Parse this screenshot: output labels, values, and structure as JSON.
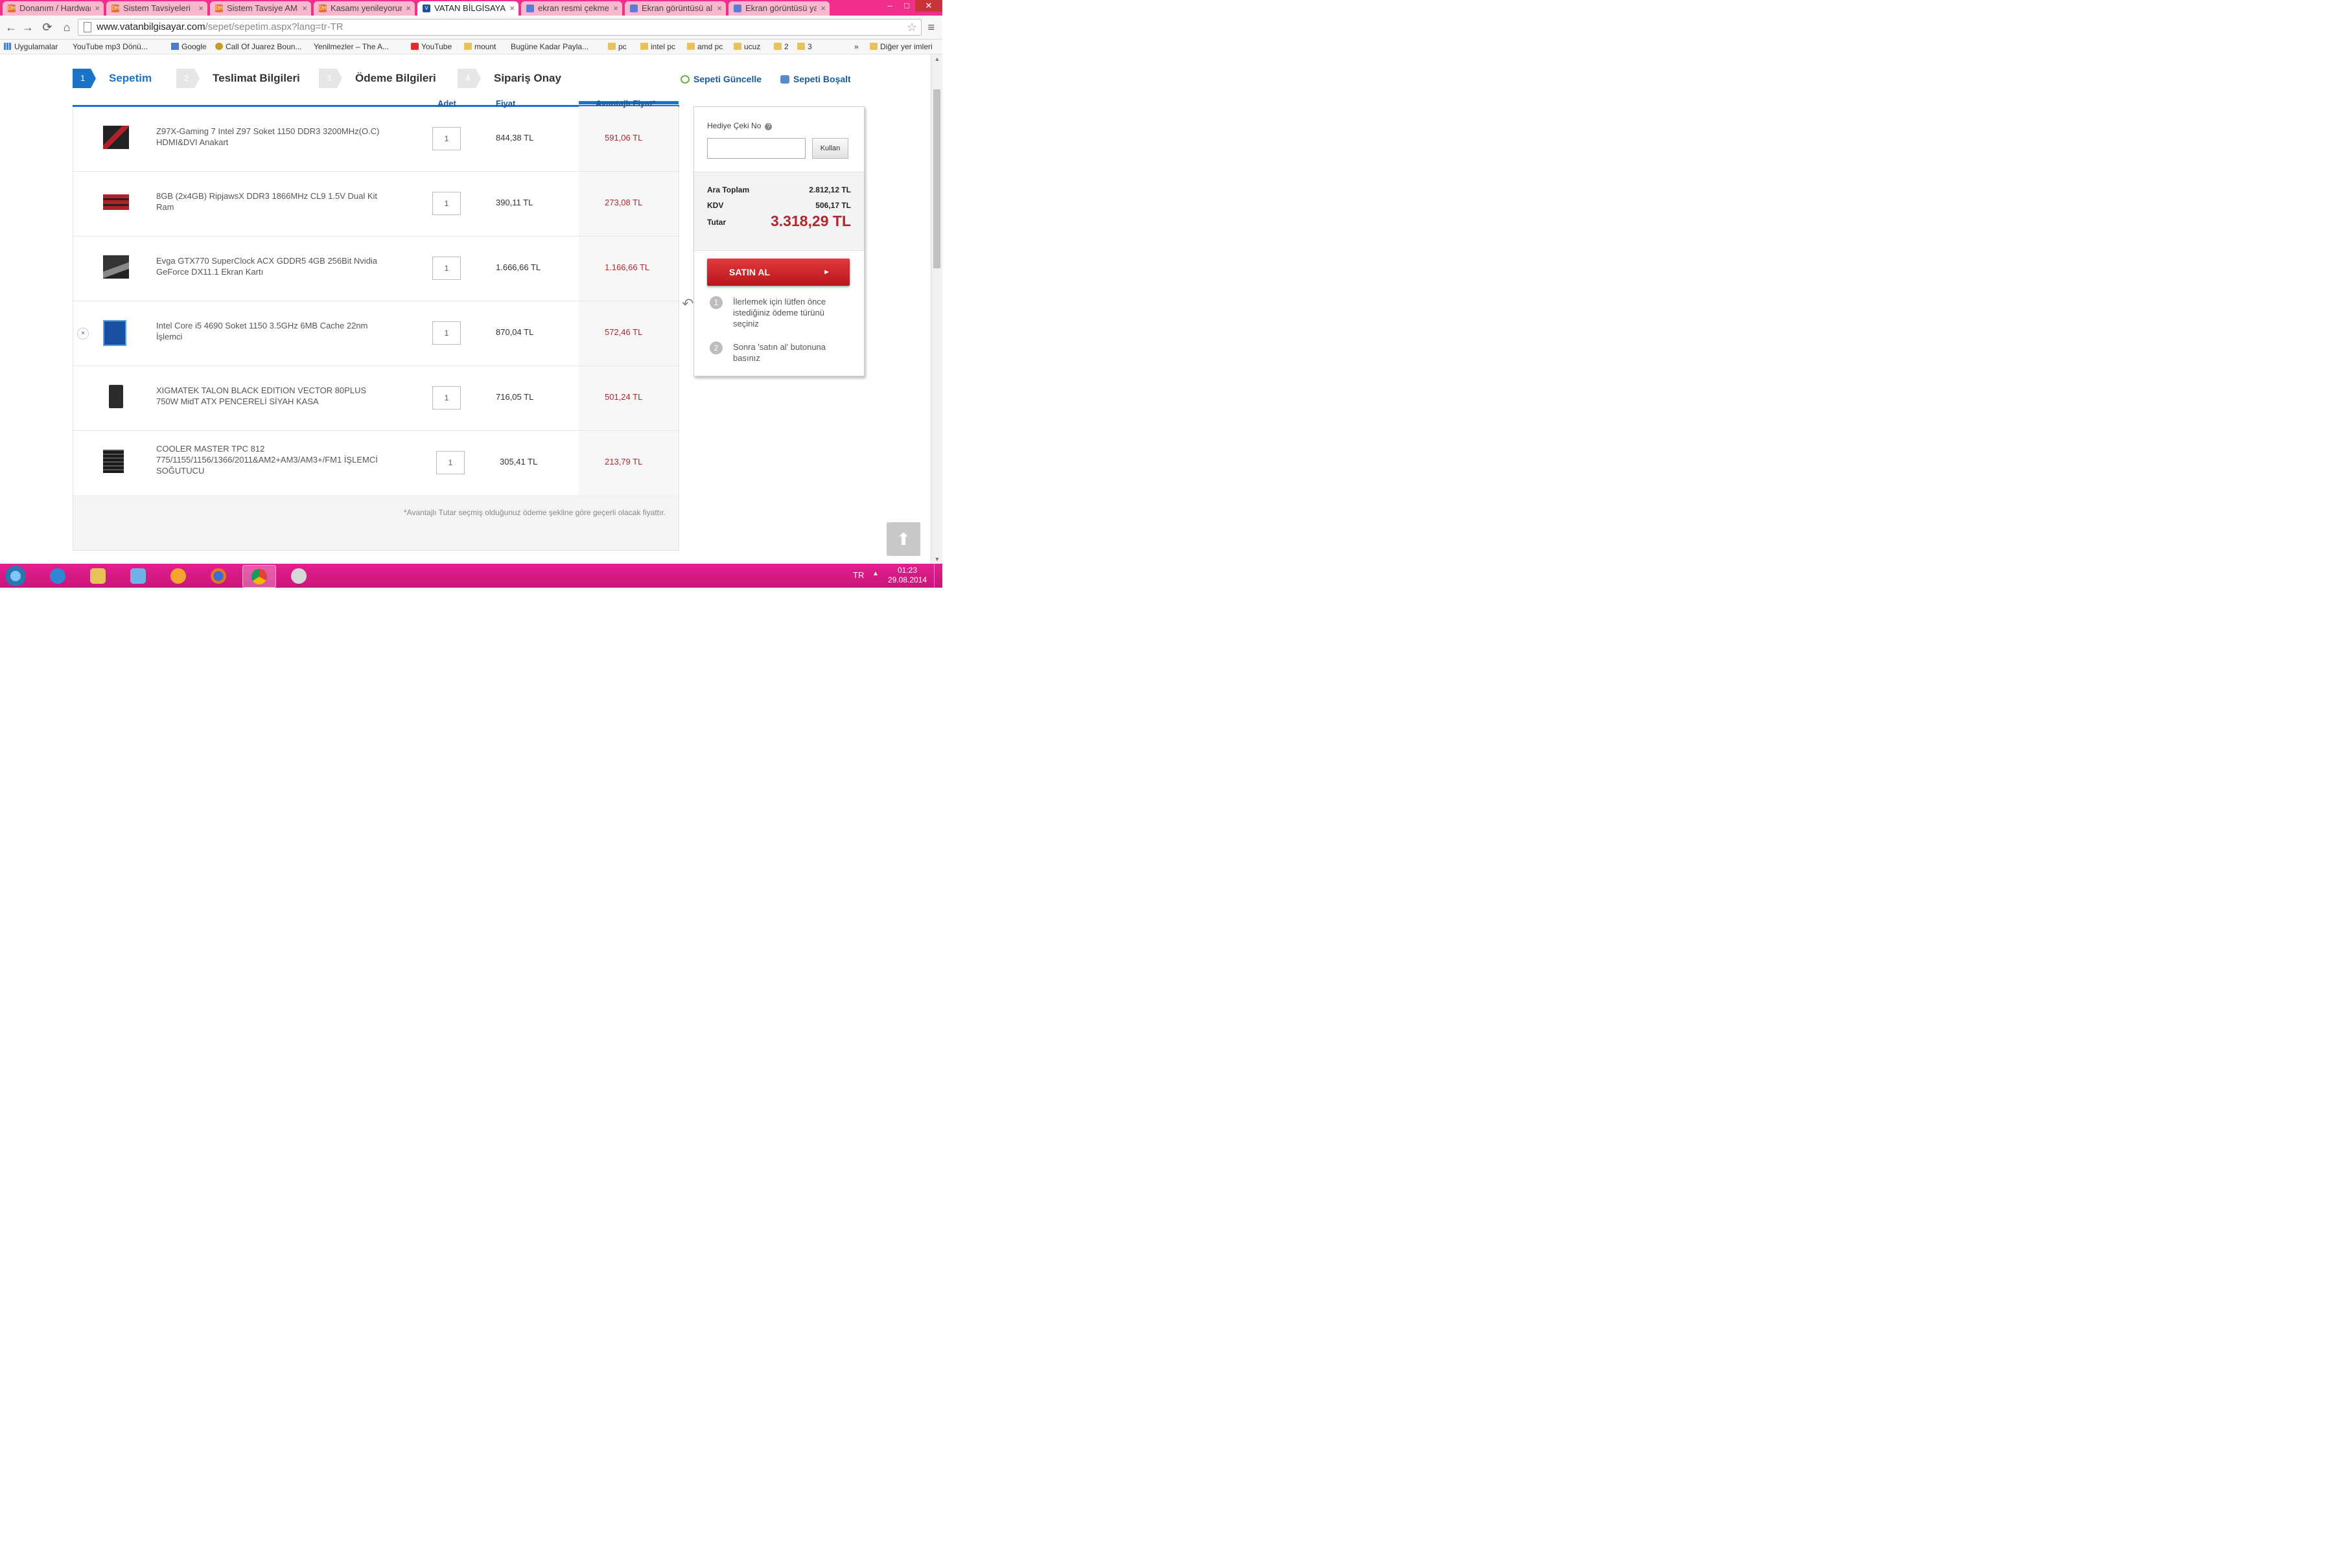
{
  "browser": {
    "tabs": [
      {
        "title": "Donanım / Hardware",
        "icon": "dh-favicon-icon",
        "active": false
      },
      {
        "title": "Sistem Tavsiyeleri",
        "icon": "dh-favicon-icon",
        "active": false
      },
      {
        "title": "Sistem Tavsiye AMD",
        "icon": "dh-favicon-icon",
        "active": false
      },
      {
        "title": "Kasamı yenileyorum",
        "icon": "dh-favicon-icon",
        "active": false
      },
      {
        "title": "VATAN BİLGİSAYAR",
        "icon": "vatan-favicon-icon",
        "active": true
      },
      {
        "title": "ekran resmi çekme",
        "icon": "generic-favicon-icon",
        "active": false
      },
      {
        "title": "Ekran görüntüsü al",
        "icon": "generic-favicon-icon",
        "active": false
      },
      {
        "title": "Ekran görüntüsü ya",
        "icon": "generic-favicon-icon",
        "active": false
      }
    ],
    "tab_close": "×",
    "url_host": "www.vatanbilgisayar.com",
    "url_path": "/sepet/sepetim.aspx?lang=tr-TR",
    "bookmarks": [
      {
        "label": "Uygulamalar",
        "icon": "apps-icon"
      },
      {
        "label": "YouTube mp3 Dönü...",
        "icon": "page-icon"
      },
      {
        "label": "Google",
        "icon": "google-icon"
      },
      {
        "label": "Call Of Juarez Boun...",
        "icon": "cod-icon"
      },
      {
        "label": "Yenilmezler – The A...",
        "icon": "page-icon"
      },
      {
        "label": "YouTube",
        "icon": "youtube-icon"
      },
      {
        "label": "mount",
        "icon": "folder-icon"
      },
      {
        "label": "Bugüne Kadar Payla...",
        "icon": "page-icon"
      },
      {
        "label": "pc",
        "icon": "folder-icon"
      },
      {
        "label": "intel pc",
        "icon": "folder-icon"
      },
      {
        "label": "amd pc",
        "icon": "folder-icon"
      },
      {
        "label": "ucuz",
        "icon": "folder-icon"
      },
      {
        "label": "2",
        "icon": "folder-icon"
      },
      {
        "label": "3",
        "icon": "folder-icon"
      }
    ],
    "bookmarks_more": "»",
    "other_bookmarks": "Diğer yer imleri"
  },
  "steps": [
    {
      "num": "1",
      "label": "Sepetim",
      "active": true
    },
    {
      "num": "2",
      "label": "Teslimat Bilgileri",
      "active": false
    },
    {
      "num": "3",
      "label": "Ödeme Bilgileri",
      "active": false
    },
    {
      "num": "4",
      "label": "Sipariş Onay",
      "active": false
    }
  ],
  "cart_actions": {
    "update": "Sepeti Güncelle",
    "empty": "Sepeti Boşalt"
  },
  "table_headers": {
    "qty": "Adet",
    "price": "Fiyat",
    "advantage_price": "Avantajlı Fiyat*"
  },
  "items": [
    {
      "name": "Z97X-Gaming 7 Intel Z97 Soket 1150 DDR3 3200MHz(O.C) HDMI&DVI Anakart",
      "qty": "1",
      "price": "844,38 TL",
      "advantage_price": "591,06 TL",
      "thumb": "motherboard-icon"
    },
    {
      "name": "8GB (2x4GB) RipjawsX DDR3 1866MHz CL9 1.5V Dual Kit Ram",
      "qty": "1",
      "price": "390,11 TL",
      "advantage_price": "273,08 TL",
      "thumb": "ram-icon"
    },
    {
      "name": "Evga GTX770 SuperClock ACX GDDR5 4GB 256Bit Nvidia GeForce DX11.1 Ekran Kartı",
      "qty": "1",
      "price": "1.666,66 TL",
      "advantage_price": "1.166,66 TL",
      "thumb": "gpu-icon"
    },
    {
      "name": "Intel Core i5 4690 Soket 1150 3.5GHz 6MB Cache 22nm İşlemci",
      "qty": "1",
      "price": "870,04 TL",
      "advantage_price": "572,46 TL",
      "thumb": "cpu-icon"
    },
    {
      "name": "XIGMATEK TALON BLACK EDITION VECTOR 80PLUS 750W MidT ATX PENCERELİ SİYAH KASA",
      "qty": "1",
      "price": "716,05 TL",
      "advantage_price": "501,24 TL",
      "thumb": "case-icon"
    },
    {
      "name": "COOLER MASTER TPC 812 775/1155/1156/1366/2011&AM2+AM3/AM3+/FM1 İŞLEMCİ SOĞUTUCU",
      "qty": "1",
      "price": "305,41 TL",
      "advantage_price": "213,79 TL",
      "thumb": "cooler-icon"
    }
  ],
  "remove_glyph": "×",
  "footnote": "*Avantajlı Tutar seçmiş olduğunuz ödeme şekline göre geçerli olacak fiyattır.",
  "summary": {
    "coupon_label": "Hediye Çeki No",
    "coupon_value": "",
    "help": "?",
    "apply_button": "Kullan",
    "subtotal_label": "Ara Toplam",
    "subtotal": "2.812,12 TL",
    "tax_label": "KDV",
    "tax": "506,17 TL",
    "total_label": "Tutar",
    "total": "3.318,29 TL",
    "buy_button": "SATIN AL",
    "buy_arrow": "►",
    "hints": [
      {
        "num": "1",
        "text": "İlerlemek için lütfen önce istediğiniz ödeme türünü seçiniz"
      },
      {
        "num": "2",
        "text": "Sonra 'satın al' butonuna basınız"
      }
    ]
  },
  "taskbar": {
    "lang": "TR",
    "time": "01:23",
    "date": "29.08.2014",
    "apps": [
      {
        "icon": "internet-explorer-icon",
        "active": false
      },
      {
        "icon": "file-explorer-icon",
        "active": false
      },
      {
        "icon": "desktop-app-icon",
        "active": false
      },
      {
        "icon": "orb-app-icon",
        "active": false
      },
      {
        "icon": "firefox-icon",
        "active": false
      },
      {
        "icon": "chrome-icon",
        "active": true
      },
      {
        "icon": "app-icon",
        "active": false
      }
    ]
  },
  "colors": {
    "accent": "#1b73c8",
    "price_red": "#b3262e",
    "buy_red": "#d6262b",
    "taskbar": "#e21f8e"
  }
}
